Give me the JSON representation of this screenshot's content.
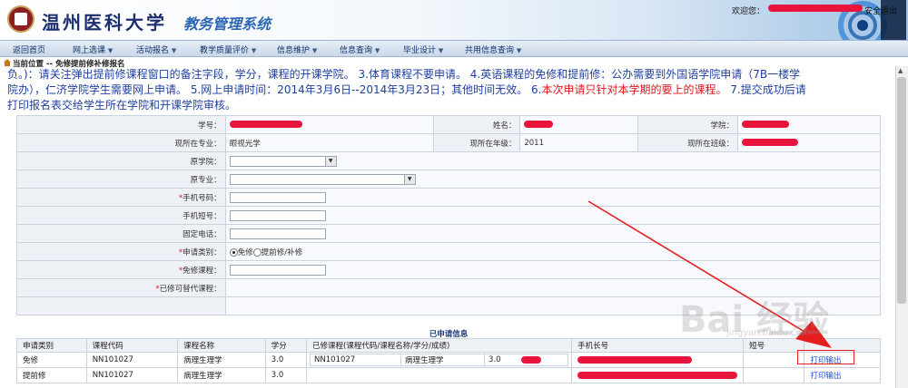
{
  "header": {
    "university": "温州医科大学",
    "system_name": "教务管理系统",
    "welcome_label": "欢迎您：",
    "logout_label": "安全退出"
  },
  "nav": {
    "items": [
      "返回首页",
      "网上选课",
      "活动报名",
      "教学质量评价",
      "信息维护",
      "信息查询",
      "毕业设计",
      "共用信息查询"
    ]
  },
  "breadcrumb": "当前位置 -- 免修提前修补修报名",
  "notice": {
    "line1": "负。)：请关注弹出提前修课程窗口的备注字段，学分，课程的开课学院。 3.体育课程不要申请。 4.英语课程的免修和提前修：公办需要到外国语学院申请（7B一楼学",
    "line2": "院办），仁济学院学生需要网上申请。 5.网上申请时间：2014年3月6日--2014年3月23日；其他时间无效。 6.",
    "line2_red": "本次申请只针对本学期的要上的课程。",
    "line2_tail": " 7.提交成功后请",
    "line3": "打印报名表交给学生所在学院和开课学院审核。"
  },
  "form": {
    "student_id_label": "学号：",
    "name_label": "姓名：",
    "college_label": "学院：",
    "major_label": "现所在专业：",
    "major_value": "眼视光学",
    "grade_label": "现所在年级：",
    "grade_value": "2011",
    "class_label": "现所在班级：",
    "orig_college_label": "原学院：",
    "orig_major_label": "原专业：",
    "mobile_label": "手机号码：",
    "short_label": "手机短号：",
    "phone_label": "固定电话：",
    "apply_type_label": "申请类别：",
    "opt_exempt": "免修",
    "opt_advance": "提前修/补修",
    "exempt_course_label": "免修课程：",
    "replace_label": "已修可替代课程：",
    "required_mark": "*"
  },
  "applied": {
    "title": "已申请信息",
    "headers": [
      "申请类别",
      "课程代码",
      "课程名称",
      "学分",
      "已修课程(课程代码/课程名称/学分/成绩)",
      "手机长号",
      "短号",
      ""
    ],
    "rows": [
      {
        "type": "免修",
        "code": "NN101027",
        "name": "病理生理学",
        "credit": "3.0",
        "done_code": "NN101027",
        "done_name": "病理生理学",
        "done_credit": "3.0",
        "print": "打印输出"
      },
      {
        "type": "提前修",
        "code": "NN101027",
        "name": "病理生理学",
        "credit": "3.0",
        "done_code": "",
        "done_name": "",
        "done_credit": "",
        "print": "打印输出"
      }
    ]
  },
  "watermark": {
    "main": "Bai 经验",
    "sub": "jingyan.baidu.com"
  },
  "colors": {
    "accent": "#2d66b5",
    "notice_blue": "#1e3fa0",
    "notice_red": "#e2141c",
    "redaction": "#e8143c"
  }
}
